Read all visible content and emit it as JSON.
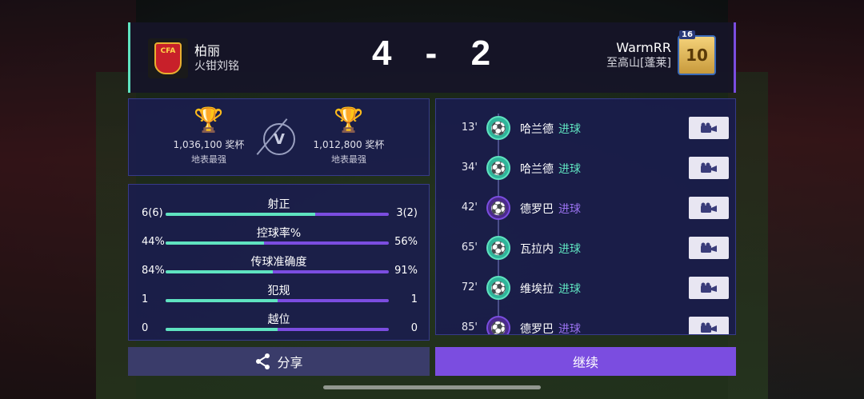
{
  "header": {
    "home": {
      "name": "柏丽",
      "subtitle": "火钳刘铭",
      "crest_text": "CFA"
    },
    "away": {
      "name": "WarmRR",
      "subtitle": "至高山[蓬莱]",
      "rank": "10",
      "rank_level": "16"
    },
    "score_home": "4",
    "score_separator": "-",
    "score_away": "2"
  },
  "trophies": {
    "home": {
      "count": "1,036,100 奖杯",
      "label": "地表最强"
    },
    "away": {
      "count": "1,012,800 奖杯",
      "label": "地表最强"
    },
    "vs": "V"
  },
  "stats": [
    {
      "label": "射正",
      "home": "6(6)",
      "away": "3(2)",
      "home_share": 0.67
    },
    {
      "label": "控球率%",
      "home": "44%",
      "away": "56%",
      "home_share": 0.44
    },
    {
      "label": "传球准确度",
      "home": "84%",
      "away": "91%",
      "home_share": 0.48
    },
    {
      "label": "犯规",
      "home": "1",
      "away": "1",
      "home_share": 0.5
    },
    {
      "label": "越位",
      "home": "0",
      "away": "0",
      "home_share": 0.5
    }
  ],
  "events": [
    {
      "minute": "13'",
      "player": "哈兰德",
      "action": "进球",
      "side": "home"
    },
    {
      "minute": "34'",
      "player": "哈兰德",
      "action": "进球",
      "side": "home"
    },
    {
      "minute": "42'",
      "player": "德罗巴",
      "action": "进球",
      "side": "away"
    },
    {
      "minute": "65'",
      "player": "瓦拉内",
      "action": "进球",
      "side": "home"
    },
    {
      "minute": "72'",
      "player": "维埃拉",
      "action": "进球",
      "side": "home"
    },
    {
      "minute": "85'",
      "player": "德罗巴",
      "action": "进球",
      "side": "away"
    }
  ],
  "buttons": {
    "share": "分享",
    "continue": "继续"
  },
  "colors": {
    "home_accent": "#5fe3c0",
    "away_accent": "#7b4de0",
    "trophy_gold": "#e5b830"
  },
  "icons": {
    "trophy": "trophy-icon",
    "ball": "football-icon",
    "replay": "video-camera-icon",
    "share": "share-icon"
  }
}
